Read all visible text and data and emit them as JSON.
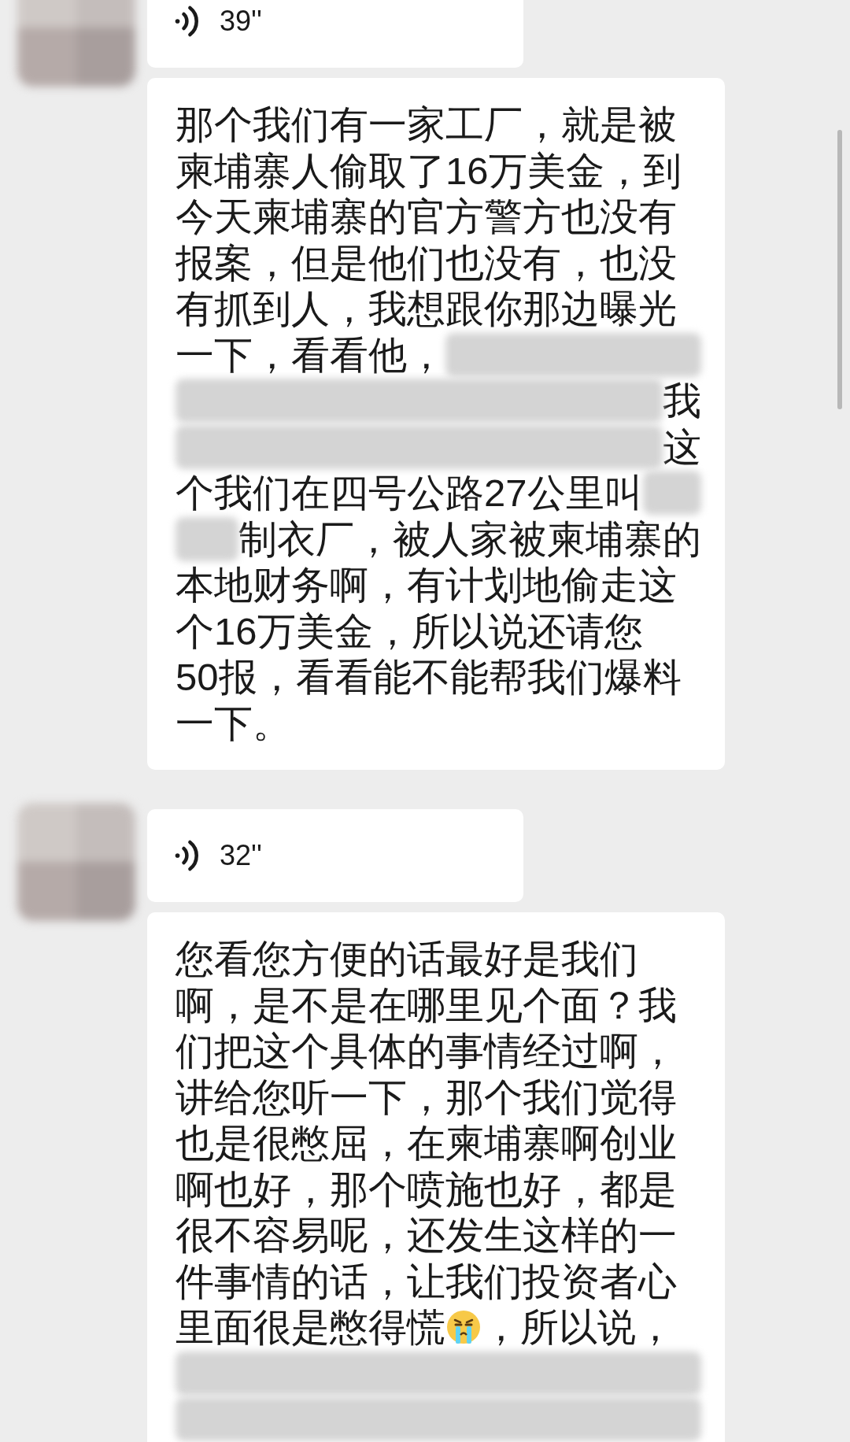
{
  "messages": [
    {
      "kind": "voice",
      "avatar": true,
      "duration": "39''"
    },
    {
      "kind": "text",
      "lines": [
        [
          {
            "kind": "text",
            "text": "那个我们有一家工厂，就是被"
          }
        ],
        [
          {
            "kind": "text",
            "text": "柬埔寨人偷取了16万美金，到"
          }
        ],
        [
          {
            "kind": "text",
            "text": "今天柬埔寨的官方警方也没有"
          }
        ],
        [
          {
            "kind": "text",
            "text": "报案，但是他们也没有，也没"
          }
        ],
        [
          {
            "kind": "text",
            "text": "有抓到人，我想跟你那边曝光"
          }
        ],
        [
          {
            "kind": "text",
            "text": "一下，看看他，"
          },
          {
            "kind": "blur"
          }
        ],
        [
          {
            "kind": "blur"
          },
          {
            "kind": "text",
            "text": "我"
          }
        ],
        [
          {
            "kind": "blur"
          },
          {
            "kind": "text",
            "text": "这"
          }
        ],
        [
          {
            "kind": "text",
            "text": "个我们在四号公路27公里叫"
          },
          {
            "kind": "blur"
          }
        ],
        [
          {
            "kind": "blur"
          },
          {
            "kind": "text",
            "text": "制衣厂，被人家被柬埔寨的"
          }
        ],
        [
          {
            "kind": "text",
            "text": "本地财务啊，有计划地偷走这"
          }
        ],
        [
          {
            "kind": "text",
            "text": "个16万美金，所以说还请您"
          }
        ],
        [
          {
            "kind": "text",
            "text": "50报，看看能不能帮我们爆料"
          }
        ],
        [
          {
            "kind": "text",
            "text": "一下。"
          }
        ]
      ]
    },
    {
      "kind": "voice",
      "avatar": true,
      "duration": "32''"
    },
    {
      "kind": "text",
      "lines": [
        [
          {
            "kind": "text",
            "text": "您看您方便的话最好是我们"
          }
        ],
        [
          {
            "kind": "text",
            "text": "啊，是不是在哪里见个面？我"
          }
        ],
        [
          {
            "kind": "text",
            "text": "们把这个具体的事情经过啊，"
          }
        ],
        [
          {
            "kind": "text",
            "text": "讲给您听一下，那个我们觉得"
          }
        ],
        [
          {
            "kind": "text",
            "text": "也是很憋屈，在柬埔寨啊创业"
          }
        ],
        [
          {
            "kind": "text",
            "text": "啊也好，那个喷施也好，都是"
          }
        ],
        [
          {
            "kind": "text",
            "text": "很不容易呢，还发生这样的一"
          }
        ],
        [
          {
            "kind": "text",
            "text": "件事情的话，让我们投资者心"
          }
        ],
        [
          {
            "kind": "text",
            "text": "里面很是憋得慌"
          },
          {
            "kind": "emoji"
          },
          {
            "kind": "text",
            "text": "，所以说，"
          }
        ],
        [
          {
            "kind": "blur"
          }
        ],
        [
          {
            "kind": "blur"
          }
        ]
      ]
    }
  ]
}
